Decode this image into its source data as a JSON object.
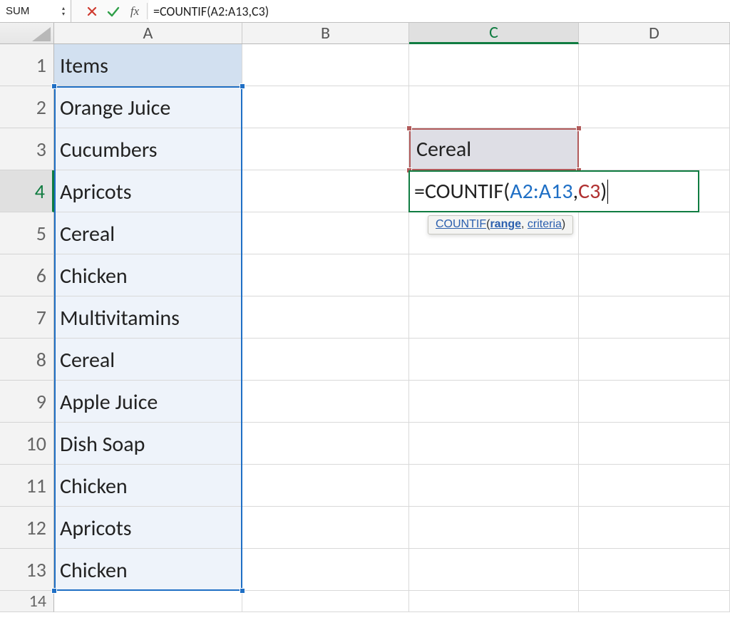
{
  "formula_bar": {
    "name_box": "SUM",
    "fx_symbol": "fx",
    "formula_text": "=COUNTIF(A2:A13,C3)"
  },
  "columns": [
    "A",
    "B",
    "C",
    "D"
  ],
  "active_column": "C",
  "active_row": "4",
  "rows": [
    "1",
    "2",
    "3",
    "4",
    "5",
    "6",
    "7",
    "8",
    "9",
    "10",
    "11",
    "12",
    "13",
    "14"
  ],
  "cells": {
    "A1": "Items",
    "A2": "Orange Juice",
    "A3": "Cucumbers",
    "A4": "Apricots",
    "A5": "Cereal",
    "A6": "Chicken",
    "A7": "Multivitamins",
    "A8": "Cereal",
    "A9": "Apple Juice",
    "A10": "Dish Soap",
    "A11": "Chicken",
    "A12": "Apricots",
    "A13": "Chicken",
    "C3": "Cereal"
  },
  "editing": {
    "prefix": "=COUNTIF(",
    "range_ref": "A2:A13",
    "comma": ",",
    "criteria_ref": "C3",
    "suffix": ")"
  },
  "tooltip": {
    "fn": "COUNTIF",
    "open": "(",
    "arg1": "range",
    "sep": ", ",
    "arg2": "criteria",
    "close": ")"
  },
  "selected_range": "A2:A13",
  "criteria_cell": "C3",
  "editing_cell": "C4"
}
